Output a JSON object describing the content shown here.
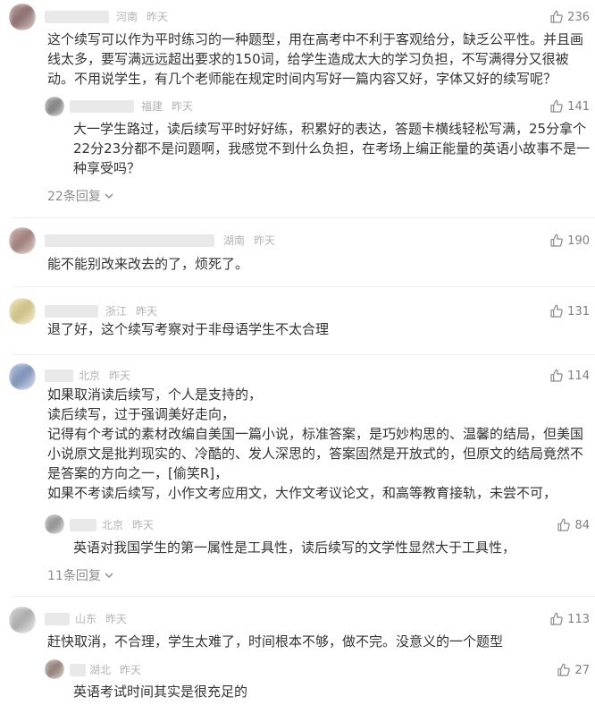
{
  "comments": [
    {
      "location": "河南",
      "time": "昨天",
      "likes": "236",
      "lines": [
        "这个续写可以作为平时练习的一种题型，用在高考中不利于客观给分，缺乏公平性。并且画",
        "线太多，要写满远远超出要求的150词，给学生造成太大的学习负担，不写满得分又很被",
        "动。不用说学生，有几个老师能在规定时间内写好一篇内容又好，字体又好的续写呢？"
      ],
      "reply": {
        "location": "福建",
        "time": "昨天",
        "likes": "141",
        "lines": [
          "大一学生路过，读后续写平时好好练，积累好的表达，答题卡横线轻松写满，25分拿个",
          "22分23分都不是问题啊，我感觉不到什么负担，在考场上编正能量的英语小故事不是一",
          "种享受吗？"
        ]
      },
      "more_replies": "22条回复"
    },
    {
      "location": "湖南",
      "time": "昨天",
      "likes": "190",
      "lines": [
        "能不能别改来改去的了，烦死了。"
      ]
    },
    {
      "location": "浙江",
      "time": "昨天",
      "likes": "131",
      "lines": [
        "退了好，这个续写考察对于非母语学生不太合理"
      ]
    },
    {
      "location": "北京",
      "time": "昨天",
      "likes": "114",
      "lines": [
        "如果取消读后续写，个人是支持的，",
        "读后续写，过于强调美好走向，",
        "记得有个考试的素材改编自美国一篇小说，标准答案，是巧妙构思的、温馨的结局，但美国",
        "小说原文是批判现实的、冷酷的、发人深思的，答案固然是开放式的，但原文的结局竟然不",
        "是答案的方向之一，[偷笑R]，",
        "如果不考读后续写，小作文考应用文，大作文考议论文，和高等教育接轨，未尝不可，"
      ],
      "reply": {
        "location": "北京",
        "time": "昨天",
        "likes": "84",
        "lines": [
          "英语对我国学生的第一属性是工具性，读后续写的文学性显然大于工具性，"
        ]
      },
      "more_replies": "11条回复"
    },
    {
      "location": "山东",
      "time": "昨天",
      "likes": "113",
      "lines": [
        "赶快取消，不合理，学生太难了，时间根本不够，做不完。没意义的一个题型"
      ],
      "reply": {
        "location": "湖北",
        "time": "昨天",
        "likes": "27",
        "lines": [
          "英语考试时间其实是很充足的"
        ]
      }
    }
  ],
  "icons": {
    "like": "thumbs-up-icon",
    "expand": "chevron-down-icon"
  },
  "colors": {
    "meta": "#b3b3b3",
    "text": "#333333",
    "more": "#8c8c8c",
    "like": "#808080"
  }
}
